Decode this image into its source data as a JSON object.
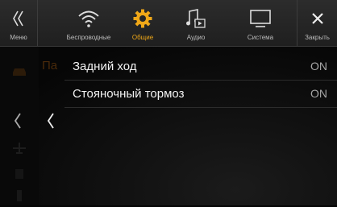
{
  "topbar": {
    "items": [
      {
        "label": "Меню",
        "icon": "double-chevron-left-icon"
      },
      {
        "label": "Беспроводные",
        "icon": "wifi-icon"
      },
      {
        "label": "Общие",
        "icon": "gear-icon",
        "active": true
      },
      {
        "label": "Аудио",
        "icon": "music-note-icon"
      },
      {
        "label": "Система",
        "icon": "monitor-icon"
      },
      {
        "label": "Закрыть",
        "icon": "close-icon"
      }
    ]
  },
  "colors": {
    "accent": "#f0a818",
    "background": "#050505",
    "topbar": "#262626"
  },
  "sidebar": {
    "faded_label": "Па"
  },
  "settings": {
    "rows": [
      {
        "title": "Задний ход",
        "value": "ON"
      },
      {
        "title": "Стояночный тормоз",
        "value": "ON"
      }
    ]
  }
}
